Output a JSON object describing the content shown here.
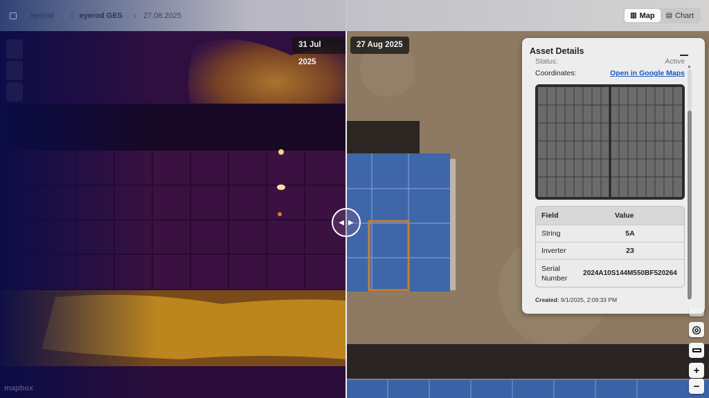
{
  "breadcrumb": {
    "items": [
      "eyerod",
      "eyerod GES",
      "27.08.2025"
    ]
  },
  "view_toggle": {
    "options": [
      {
        "label": "Map",
        "icon": "map-icon",
        "active": true
      },
      {
        "label": "Chart",
        "icon": "document-icon",
        "active": false
      }
    ]
  },
  "compare": {
    "left_date": "31 Jul 2025",
    "right_date": "27 Aug 2025",
    "left_layer": "thermal",
    "right_layer": "rgb"
  },
  "asset_panel": {
    "title": "Asset Details",
    "status_label": "Status:",
    "status_value": "Active",
    "coordinates_label": "Coordinates:",
    "coordinates_link": "Open in Google Maps",
    "table": {
      "headers": [
        "Field",
        "Value"
      ],
      "rows": [
        {
          "field": "String",
          "value": "5A"
        },
        {
          "field": "Inverter",
          "value": "23"
        },
        {
          "field": "Serial Number",
          "value": "2024A10S144M550BF520264"
        }
      ]
    },
    "created_label": "Created:",
    "created_value": "9/1/2025, 2:09:33 PM"
  },
  "map_controls": [
    "locate-icon",
    "ruler-icon",
    "zoom-in-icon",
    "zoom-out-icon"
  ],
  "attribution": "mapbox",
  "colors": {
    "panel_bg": "#ededed",
    "link": "#1a56c4",
    "selection": "#c8802a",
    "panel_blue": "#3f66a8"
  }
}
